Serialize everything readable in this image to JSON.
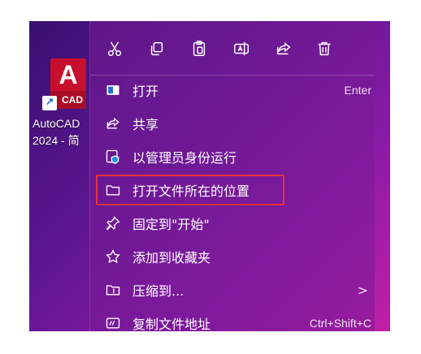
{
  "desktop": {
    "shortcut": {
      "icon_letter": "A",
      "icon_badge": "CAD",
      "label_line1": "AutoCAD",
      "label_line2": "2024 - 简"
    }
  },
  "context_menu": {
    "toolbar": [
      {
        "id": "cut",
        "icon": "scissors-icon"
      },
      {
        "id": "copy",
        "icon": "copy-icon"
      },
      {
        "id": "paste",
        "icon": "paste-icon"
      },
      {
        "id": "rename",
        "icon": "rename-icon"
      },
      {
        "id": "share",
        "icon": "share-icon"
      },
      {
        "id": "delete",
        "icon": "trash-icon"
      }
    ],
    "items": [
      {
        "label": "打开",
        "shortcut": "Enter",
        "icon": "open-app-icon"
      },
      {
        "label": "共享",
        "icon": "share-icon"
      },
      {
        "label": "以管理员身份运行",
        "icon": "shield-icon"
      },
      {
        "label": "打开文件所在的位置",
        "icon": "folder-icon",
        "highlighted": true
      },
      {
        "label": "固定到\"开始\"",
        "icon": "pin-icon"
      },
      {
        "label": "添加到收藏夹",
        "icon": "star-icon"
      },
      {
        "label": "压缩到...",
        "icon": "zip-folder-icon",
        "submenu": ">"
      },
      {
        "label": "复制文件地址",
        "shortcut": "Ctrl+Shift+C",
        "icon": "copy-path-icon"
      }
    ]
  },
  "colors": {
    "highlight_border": "#e8333a",
    "autocad_red": "#c8102e"
  }
}
